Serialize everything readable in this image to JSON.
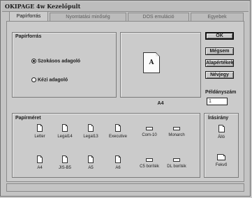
{
  "window": {
    "title": "OKIPAGE 4w Kezelőpult"
  },
  "tabs": [
    {
      "label": "Papírforrás",
      "active": true
    },
    {
      "label": "Nyomtatási minőség",
      "active": false
    },
    {
      "label": "DOS emuláció",
      "active": false
    },
    {
      "label": "Egyebek",
      "active": false
    }
  ],
  "paper_source": {
    "group_label": "Papírforrás",
    "options": [
      {
        "label": "Szokásos adagoló",
        "selected": true
      },
      {
        "label": "Kézi adagoló",
        "selected": false
      }
    ]
  },
  "preview": {
    "letter": "A",
    "caption": "A4"
  },
  "buttons": {
    "ok": "OK",
    "cancel": "Mégsem",
    "defaults": "Alapértékek",
    "about": "Névjegy"
  },
  "copies": {
    "label": "Példányszám",
    "value": "1"
  },
  "paper_size": {
    "group_label": "Papírméret",
    "items": [
      {
        "label": "Letter",
        "icon": "sheet-icon"
      },
      {
        "label": "Legal14",
        "icon": "sheet-icon"
      },
      {
        "label": "Legal13",
        "icon": "sheet-icon"
      },
      {
        "label": "Executive",
        "icon": "sheet-icon"
      },
      {
        "label": "Com-10",
        "icon": "envelope-icon"
      },
      {
        "label": "Monarch",
        "icon": "envelope-icon"
      },
      {
        "label": "A4",
        "icon": "sheet-icon"
      },
      {
        "label": "JIS-B5",
        "icon": "sheet-icon"
      },
      {
        "label": "A5",
        "icon": "sheet-icon"
      },
      {
        "label": "A6",
        "icon": "sheet-icon"
      },
      {
        "label": "C5 boríték",
        "icon": "envelope-icon"
      },
      {
        "label": "DL boríték",
        "icon": "envelope-icon"
      }
    ]
  },
  "orientation": {
    "group_label": "Írásirány",
    "options": [
      {
        "label": "Álló",
        "icon": "portrait-icon"
      },
      {
        "label": "Fekvő",
        "icon": "landscape-icon"
      }
    ]
  }
}
